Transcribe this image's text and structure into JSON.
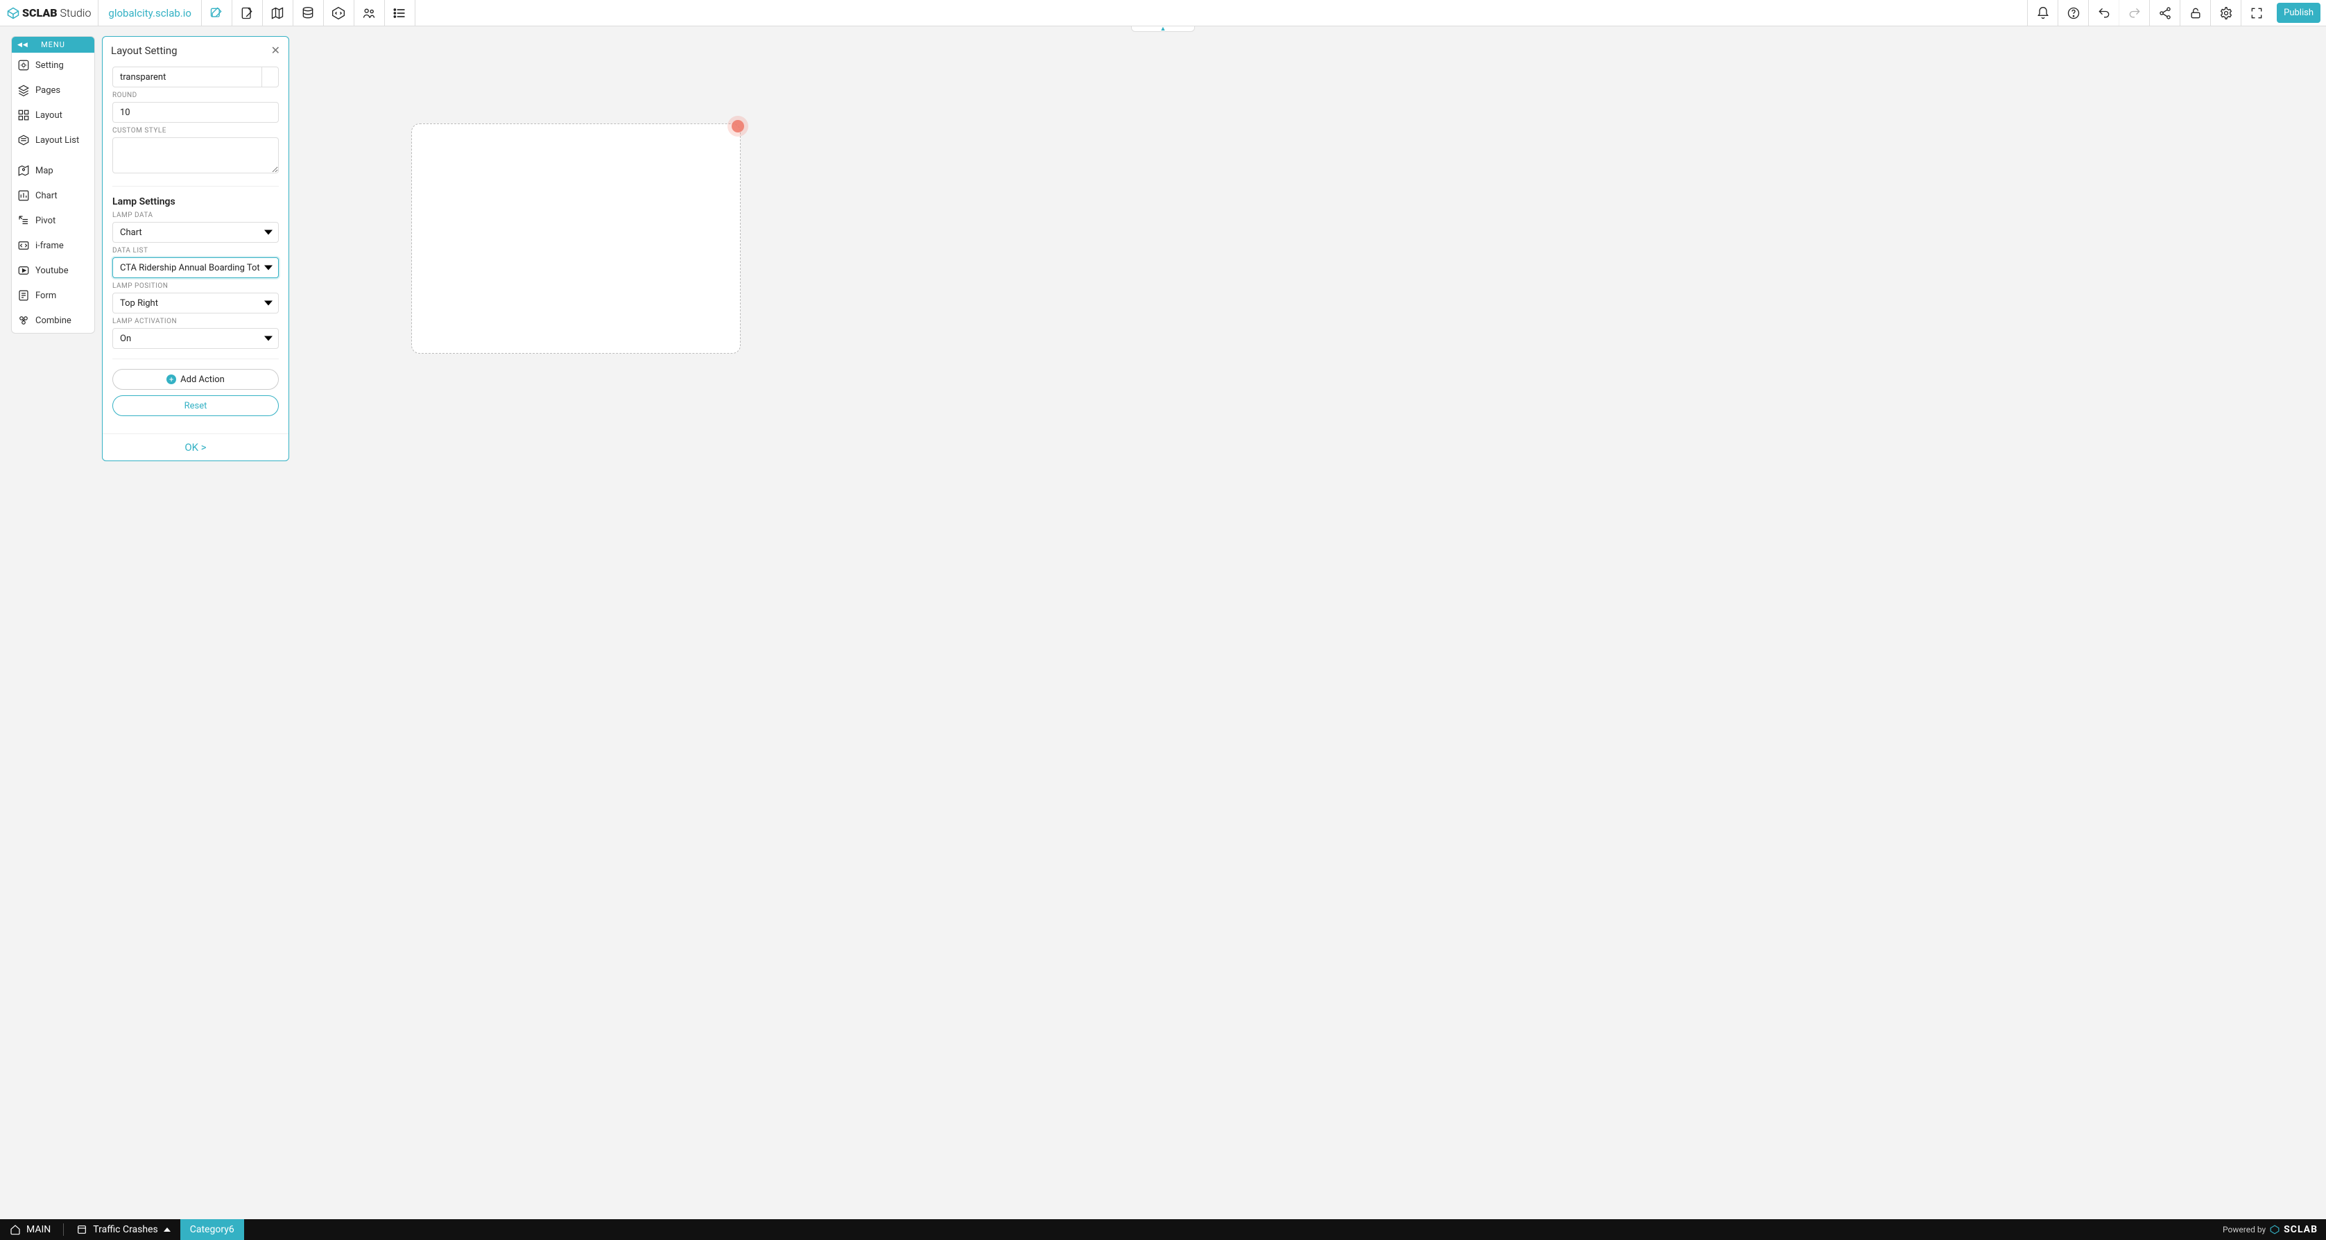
{
  "app": {
    "brand_main": "SCLAB",
    "brand_sub": "Studio",
    "project_url": "globalcity.sclab.io"
  },
  "topbar": {
    "publish_label": "Publish"
  },
  "sidebar": {
    "menu_label": "MENU",
    "items": [
      {
        "label": "Setting"
      },
      {
        "label": "Pages"
      },
      {
        "label": "Layout"
      },
      {
        "label": "Layout List"
      },
      {
        "label": "Map"
      },
      {
        "label": "Chart"
      },
      {
        "label": "Pivot"
      },
      {
        "label": "i-frame"
      },
      {
        "label": "Youtube"
      },
      {
        "label": "Form"
      },
      {
        "label": "Combine"
      }
    ]
  },
  "panel": {
    "title": "Layout Setting",
    "color_value": "transparent",
    "round_label": "Round",
    "round_value": "10",
    "custom_style_label": "Custom Style",
    "custom_style_value": "",
    "lamp_section": "Lamp Settings",
    "lamp_data_label": "Lamp Data",
    "lamp_data_value": "Chart",
    "data_list_label": "Data List",
    "data_list_value": "CTA Ridership Annual Boarding Tot",
    "lamp_pos_label": "Lamp Position",
    "lamp_pos_value": "Top Right",
    "lamp_act_label": "Lamp Activation",
    "lamp_act_value": "On",
    "add_action": "Add Action",
    "reset": "Reset",
    "ok": "OK >"
  },
  "bottombar": {
    "main": "MAIN",
    "tab1": "Traffic Crashes",
    "tab2": "Category6",
    "powered": "Powered by",
    "brand": "SCLAB"
  }
}
